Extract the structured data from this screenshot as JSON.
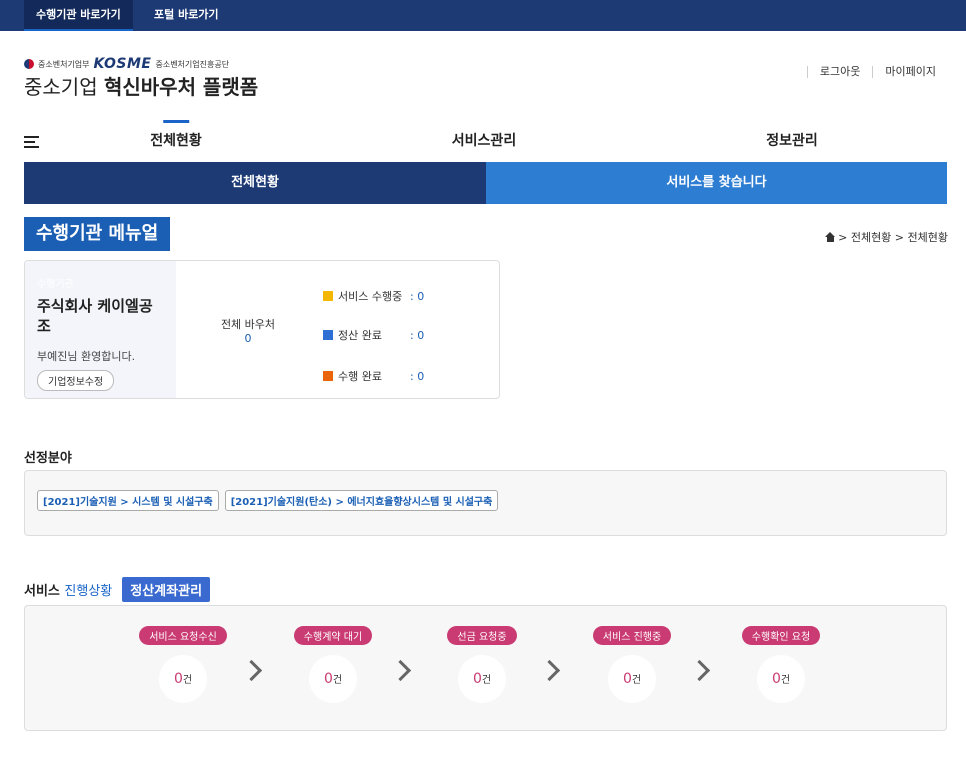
{
  "topbar": {
    "links": [
      "수행기관 바로가기",
      "포털 바로가기"
    ]
  },
  "header": {
    "logo_ministry": "중소벤처기업부",
    "logo_brand": "KOSME",
    "logo_org": "중소벤처기업진흥공단",
    "title_prefix": "중소기업",
    "title_main": "혁신바우처 플랫폼",
    "util_links": [
      "로그아웃",
      "마이페이지"
    ]
  },
  "gnb": {
    "items": [
      "전체현황",
      "서비스관리",
      "정보관리"
    ],
    "active": "전체현황"
  },
  "subnav": {
    "current": "전체현황",
    "search": "서비스를 찾습니다"
  },
  "page": {
    "title": "수행기관 메뉴얼",
    "breadcrumb": "> 전체현황 > 전체현황"
  },
  "company": {
    "role": "수행기관",
    "name": "주식회사 케이엘공조",
    "welcome": "부예진님 환영합니다.",
    "edit_button": "기업정보수정",
    "total_label": "전체 바우처",
    "total_value": "0",
    "stats": [
      {
        "label": "서비스 수행중",
        "value": ": 0",
        "color": "#f5b800"
      },
      {
        "label": "정산 완료",
        "value": ": 0",
        "color": "#2d6fd2"
      },
      {
        "label": "수행 완료",
        "value": ": 0",
        "color": "#e8650a"
      }
    ]
  },
  "selected_fields": {
    "title": "선정분야",
    "tags": [
      "[2021]기술지원 > 시스템 및 시설구축",
      "[2021]기술지원(탄소) > 에너지효율향상시스템 및 시설구축"
    ]
  },
  "progress": {
    "title_prefix": "서비스",
    "title_suffix": "진행상황",
    "settle_button": "정산계좌관리",
    "steps": [
      {
        "label": "서비스 요청수신",
        "count": "0",
        "unit": "건"
      },
      {
        "label": "수행계약 대기",
        "count": "0",
        "unit": "건"
      },
      {
        "label": "선금 요청중",
        "count": "0",
        "unit": "건"
      },
      {
        "label": "서비스 진행중",
        "count": "0",
        "unit": "건"
      },
      {
        "label": "수행확인 요청",
        "count": "0",
        "unit": "건"
      }
    ]
  }
}
